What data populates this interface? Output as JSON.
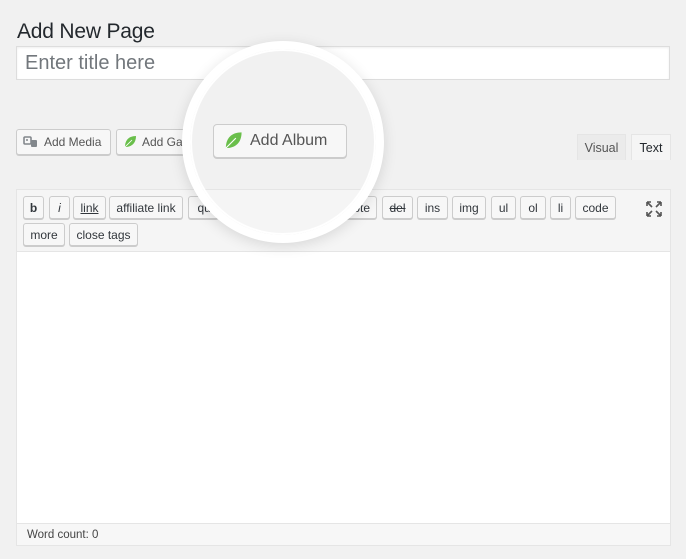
{
  "page_title": "Add New Page",
  "title_field": {
    "placeholder": "Enter title here",
    "value": ""
  },
  "media_buttons": {
    "add_media": "Add Media",
    "add_gallery": "Add Gallery",
    "add_album": "Add Album"
  },
  "editor_tabs": {
    "visual": "Visual",
    "text": "Text",
    "active": "text"
  },
  "quicktags": [
    "b",
    "i",
    "link",
    "affiliate link",
    "quote",
    "del",
    "ins",
    "img",
    "ul",
    "ol",
    "li",
    "code",
    "more",
    "close tags"
  ],
  "quicktags_hidden": [
    "b-quote"
  ],
  "word_count": "Word count: 0",
  "colors": {
    "leaf_green": "#6abf4b",
    "background": "#f1f1f1"
  },
  "icons": {
    "media": "media-icon",
    "leaf": "leaf-icon",
    "fullscreen": "fullscreen-icon"
  }
}
